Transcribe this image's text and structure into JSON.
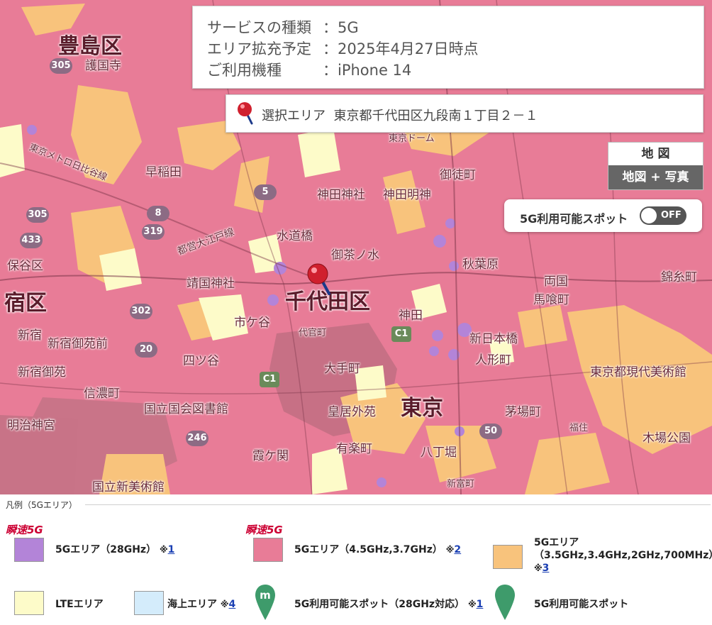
{
  "info": {
    "rows": [
      {
        "label": "サービスの種類",
        "sep": "：",
        "value": "5G"
      },
      {
        "label": "エリア拡充予定",
        "sep": "：",
        "value": "2025年4月27日時点"
      },
      {
        "label": "ご利用機種",
        "sep": "：",
        "value": "iPhone 14"
      }
    ]
  },
  "selection": {
    "prefix": "選択エリア",
    "address": "東京都千代田区九段南１丁目２－１"
  },
  "map_type": {
    "map": "地 図",
    "photo": "地図 + 写真"
  },
  "spot_toggle": {
    "label": "5G利用可能スポット",
    "state": "OFF"
  },
  "map_labels": [
    {
      "text": "豊島区"
    },
    {
      "text": "護国寺"
    },
    {
      "text": "早稲田"
    },
    {
      "text": "神田神社"
    },
    {
      "text": "神田明神"
    },
    {
      "text": "御徒町"
    },
    {
      "text": "水道橋"
    },
    {
      "text": "御茶ノ水"
    },
    {
      "text": "秋葉原"
    },
    {
      "text": "靖国神社"
    },
    {
      "text": "千代田区"
    },
    {
      "text": "両国"
    },
    {
      "text": "錦糸町"
    },
    {
      "text": "市ケ谷"
    },
    {
      "text": "神田"
    },
    {
      "text": "馬喰町"
    },
    {
      "text": "新宿"
    },
    {
      "text": "新宿御苑前"
    },
    {
      "text": "代官町"
    },
    {
      "text": "新日本橋"
    },
    {
      "text": "人形町"
    },
    {
      "text": "四ツ谷"
    },
    {
      "text": "大手町"
    },
    {
      "text": "新宿御苑"
    },
    {
      "text": "信濃町"
    },
    {
      "text": "東京"
    },
    {
      "text": "茅場町"
    },
    {
      "text": "東京都現代美術館"
    },
    {
      "text": "国立国会図書館"
    },
    {
      "text": "皇居外苑"
    },
    {
      "text": "明治神宮"
    },
    {
      "text": "霞ケ関"
    },
    {
      "text": "有楽町"
    },
    {
      "text": "八丁堀"
    },
    {
      "text": "木場公園"
    },
    {
      "text": "国立新美術館"
    },
    {
      "text": "新富町"
    },
    {
      "text": "都営大江戸線"
    },
    {
      "text": "東京メトロ日比谷線"
    },
    {
      "text": "保谷区"
    },
    {
      "text": "宿区"
    },
    {
      "text": "福住"
    },
    {
      "text": "東京ドーム"
    }
  ],
  "routes": [
    "305",
    "305",
    "433",
    "319",
    "302",
    "20",
    "5",
    "8",
    "246",
    "50",
    "C1",
    "C1"
  ],
  "legend": {
    "title": "凡例（5Gエリア）",
    "brand": "瞬速5G",
    "items": [
      {
        "label": "5Gエリア（28GHz）",
        "note": "※",
        "ref": "1",
        "color": "#b384d8"
      },
      {
        "label": "5Gエリア（4.5GHz,3.7GHz）",
        "note": "※",
        "ref": "2",
        "color": "#e87c97"
      },
      {
        "label": "5Gエリア",
        "sub": "（3.5GHz,3.4GHz,2GHz,700MHz）",
        "note": "※",
        "ref": "3",
        "color": "#f8c37c"
      },
      {
        "label": "LTEエリア",
        "color": "#fdfbc9"
      },
      {
        "label": "海上エリア",
        "note": "※",
        "ref": "4",
        "color": "#d4ecfb"
      },
      {
        "label": "5G利用可能スポット（28GHz対応）",
        "note": "※",
        "ref": "1",
        "color": "#3e9b6b",
        "pin_letter": "m"
      },
      {
        "label": "5G利用可能スポット",
        "color": "#3e9b6b"
      }
    ]
  }
}
